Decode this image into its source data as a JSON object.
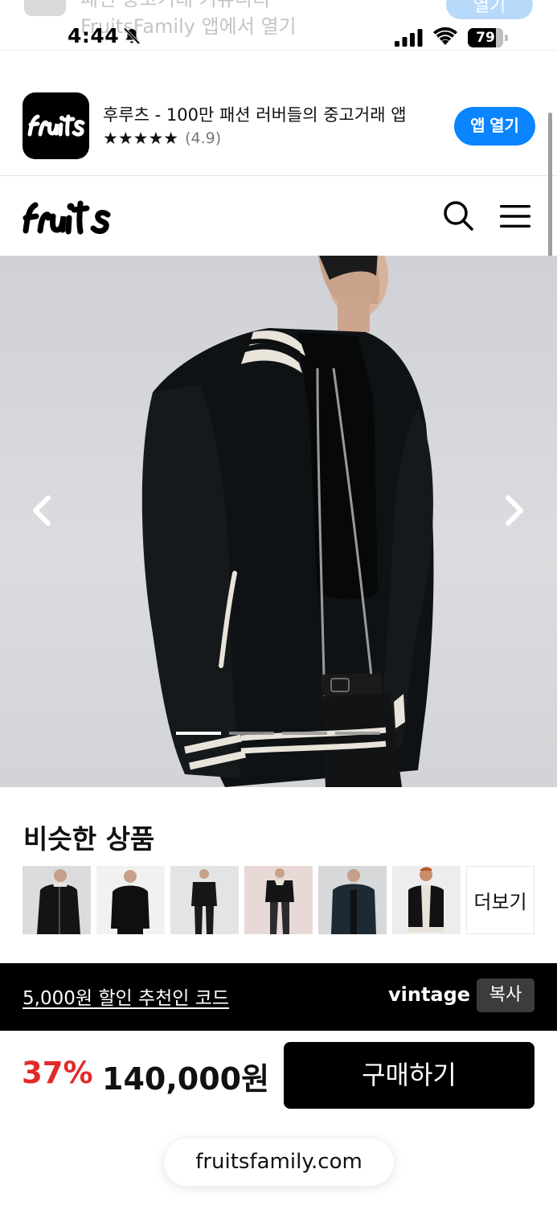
{
  "status_bar": {
    "ghost_banner_line1": "패션 중고거래 커뮤니티",
    "ghost_banner_line2": "FruitsFamily 앱에서 열기",
    "ghost_button": "열기",
    "time": "4:44",
    "battery": "79",
    "battery_level": 0.79
  },
  "app_banner": {
    "title": "후루츠 - 100만 패션 러버들의 중고거래 앱",
    "stars": "★★★★★",
    "rating": "(4.9)",
    "open_button": "앱 열기",
    "icon_name": "fruits-app-icon"
  },
  "header": {
    "logo_name": "fruits-logo",
    "search_icon": "search-icon",
    "menu_icon": "menu-icon"
  },
  "gallery": {
    "image_count": 4,
    "active_index": 0
  },
  "similar": {
    "title": "비슷한 상품",
    "more_label": "더보기"
  },
  "referral": {
    "text": "5,000원 할인 추천인 코드",
    "code": "vintage",
    "copy_label": "복사"
  },
  "purchase": {
    "discount": "37%",
    "price": "140,000원",
    "buy_label": "구매하기"
  },
  "url": {
    "domain": "fruitsfamily.com"
  },
  "colors": {
    "accent_blue": "#0a84ff",
    "discount_red": "#e22a2a",
    "black": "#000000"
  }
}
